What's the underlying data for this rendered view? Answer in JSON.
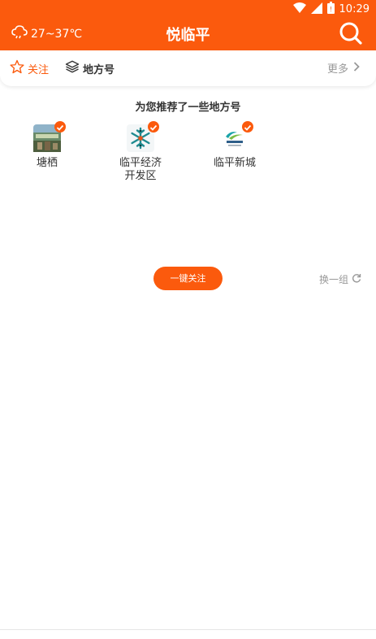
{
  "status_bar": {
    "time": "10:29",
    "icons": [
      "wifi-icon",
      "signal-icon",
      "battery-icon"
    ]
  },
  "header": {
    "weather": "27~37℃",
    "weather_icon": "cloud-rain-icon",
    "title": "悦临平",
    "search_icon": "search-icon",
    "background_color": "#fb5a0d"
  },
  "tabs": {
    "follow_label": "关注",
    "follow_icon": "star-icon",
    "local_label": "地方号",
    "local_icon": "layers-icon",
    "more_label": "更多",
    "more_icon": "chevron-right-icon",
    "active_color": "#fb5a0d"
  },
  "recommend": {
    "title": "为您推荐了一些地方号",
    "accounts": [
      {
        "name": "塘栖",
        "logo": "photo-thumbnail",
        "checked": true
      },
      {
        "name": "临平经济开发区",
        "name_line1": "临平经济",
        "name_line2": "开发区",
        "logo": "snowflake-logo",
        "checked": true
      },
      {
        "name": "临平新城",
        "logo": "linping-newtown-logo",
        "checked": true
      }
    ],
    "follow_all_label": "一键关注",
    "refresh_label": "换一组",
    "refresh_icon": "refresh-icon"
  },
  "bottom_nav": {
    "icons": [
      "news-icon",
      "home-icon",
      "circle-icon",
      "crown-icon",
      "user-icon"
    ]
  }
}
